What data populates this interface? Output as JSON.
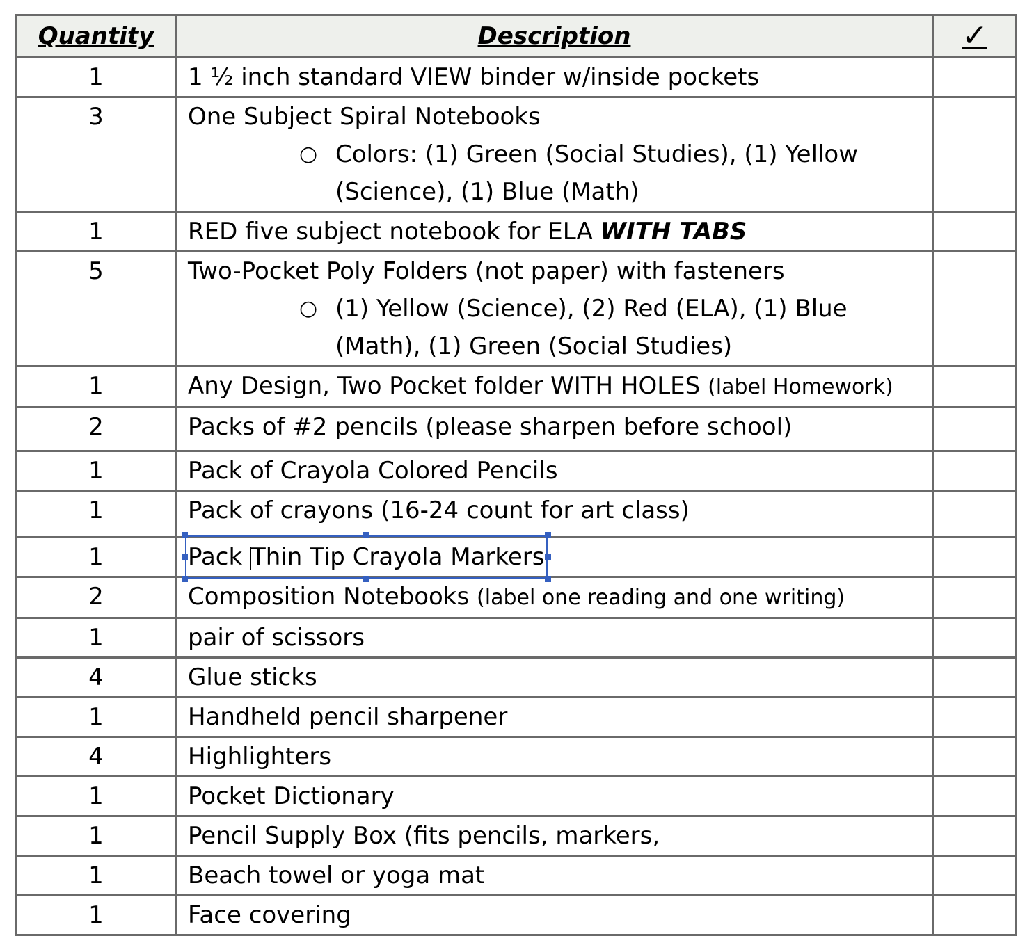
{
  "headers": {
    "quantity": "Quantity",
    "description": "Description",
    "check": "✓"
  },
  "rows": [
    {
      "qty": "1",
      "desc": "1 ½ inch standard VIEW binder w/inside pockets"
    },
    {
      "qty": "3",
      "desc": "One Subject Spiral Notebooks",
      "sub": "Colors: (1) Green (Social Studies), (1) Yellow (Science), (1) Blue (Math)"
    },
    {
      "qty": "1",
      "desc": "RED five subject notebook for ELA ",
      "emph": "WITH TABS"
    },
    {
      "qty": "5",
      "desc": "Two-Pocket Poly Folders (not paper) with fasteners",
      "sub": "(1) Yellow (Science), (2) Red (ELA), (1) Blue (Math), (1) Green (Social Studies)"
    },
    {
      "qty": "1",
      "desc": "Any Design, Two Pocket folder WITH HOLES ",
      "small": "(label Homework)"
    },
    {
      "qty": "2",
      "desc": "Packs of #2 pencils (please sharpen before school)"
    },
    {
      "qty": "1",
      "desc": "Pack of Crayola Colored Pencils"
    },
    {
      "qty": "1",
      "desc": "Pack of crayons (16-24 count for art class)"
    },
    {
      "qty": "1",
      "desc_a": "Pack ",
      "desc_b": "Thin Tip Crayola Markers"
    },
    {
      "qty": "2",
      "desc": "Composition Notebooks ",
      "small": "(label one reading and one writing)"
    },
    {
      "qty": "1",
      "desc": "pair of scissors"
    },
    {
      "qty": "4",
      "desc": "Glue sticks"
    },
    {
      "qty": "1",
      "desc": "Handheld pencil sharpener"
    },
    {
      "qty": "4",
      "desc": "Highlighters"
    },
    {
      "qty": "1",
      "desc": "Pocket Dictionary"
    },
    {
      "qty": "1",
      "desc": "Pencil Supply Box (fits pencils, markers,"
    },
    {
      "qty": "1",
      "desc": "Beach towel or yoga mat"
    },
    {
      "qty": "1",
      "desc": "Face covering"
    }
  ],
  "selection_color": "#3560c0"
}
